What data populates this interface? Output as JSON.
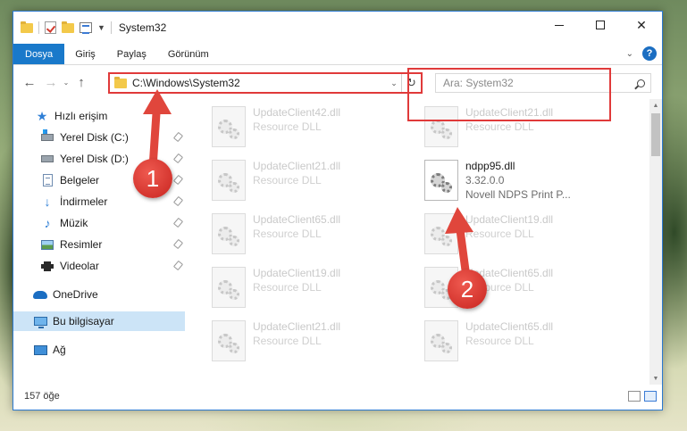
{
  "window": {
    "title": "System32",
    "ribbon_tabs": [
      "Dosya",
      "Giriş",
      "Paylaş",
      "Görünüm"
    ]
  },
  "address": {
    "path": "C:\\Windows\\System32",
    "search_placeholder": "Ara: System32"
  },
  "nav": {
    "items": [
      {
        "label": "Hızlı erişim",
        "icon": "star-icon"
      },
      {
        "label": "Yerel Disk (C:)",
        "icon": "drive-c-icon"
      },
      {
        "label": "Yerel Disk (D:)",
        "icon": "drive-d-icon"
      },
      {
        "label": "Belgeler",
        "icon": "documents-icon"
      },
      {
        "label": "İndirmeler",
        "icon": "downloads-icon"
      },
      {
        "label": "Müzik",
        "icon": "music-icon"
      },
      {
        "label": "Resimler",
        "icon": "pictures-icon"
      },
      {
        "label": "Videolar",
        "icon": "videos-icon"
      },
      {
        "label": "OneDrive",
        "icon": "onedrive-icon"
      },
      {
        "label": "Bu bilgisayar",
        "icon": "this-pc-icon"
      },
      {
        "label": "Ağ",
        "icon": "network-icon"
      }
    ]
  },
  "files": {
    "left": [
      {
        "name": "UpdateClient42.dll",
        "sub": "Resource DLL"
      },
      {
        "name": "UpdateClient21.dll",
        "sub": "Resource DLL"
      },
      {
        "name": "UpdateClient65.dll",
        "sub": "Resource DLL"
      },
      {
        "name": "UpdateClient19.dll",
        "sub": "Resource DLL"
      },
      {
        "name": "UpdateClient21.dll",
        "sub": "Resource DLL"
      }
    ],
    "right": [
      {
        "name": "UpdateClient21.dll",
        "sub": "Resource DLL"
      },
      {
        "name": "ndpp95.dll",
        "sub": "3.32.0.0",
        "sub2": "Novell NDPS Print P..."
      },
      {
        "name": "UpdateClient19.dll",
        "sub": "Resource DLL"
      },
      {
        "name": "UpdateClient65.dll",
        "sub": "Resource DLL"
      },
      {
        "name": "UpdateClient65.dll",
        "sub": "Resource DLL"
      }
    ]
  },
  "status": {
    "count": "157 öğe"
  },
  "callouts": [
    "1",
    "2"
  ],
  "colors": {
    "accent": "#1979ca",
    "highlight": "#e03a3a",
    "selection": "#cce4f7"
  }
}
